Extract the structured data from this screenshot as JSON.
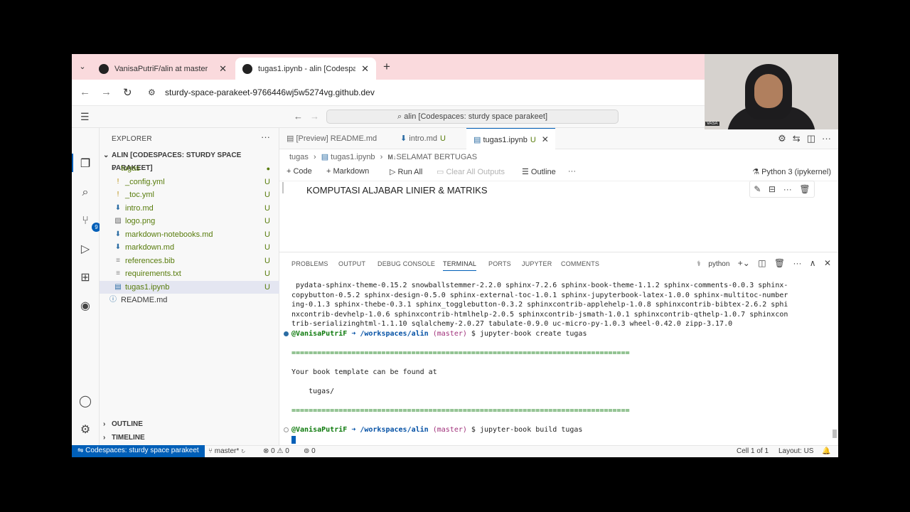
{
  "browser": {
    "tabs": [
      {
        "label": "VanisaPutriF/alin at master",
        "active": false
      },
      {
        "label": "tugas1.ipynb - alin [Codespaces",
        "active": true
      }
    ],
    "url": "sturdy-space-parakeet-9766446wj5w5274vg.github.dev"
  },
  "vscode": {
    "command_center": "alin [Codespaces: sturdy space parakeet]",
    "explorer": {
      "title": "EXPLORER",
      "workspace": "ALIN [CODESPACES: STURDY SPACE PARAKEET]",
      "folder": "tugas",
      "files": [
        {
          "name": "_config.yml",
          "icon": "!",
          "status": "U"
        },
        {
          "name": "_toc.yml",
          "icon": "!",
          "status": "U"
        },
        {
          "name": "intro.md",
          "icon": "⬇",
          "status": "U"
        },
        {
          "name": "logo.png",
          "icon": "▨",
          "status": "U"
        },
        {
          "name": "markdown-notebooks.md",
          "icon": "⬇",
          "status": "U"
        },
        {
          "name": "markdown.md",
          "icon": "⬇",
          "status": "U"
        },
        {
          "name": "references.bib",
          "icon": "≡",
          "status": "U"
        },
        {
          "name": "requirements.txt",
          "icon": "≡",
          "status": "U"
        },
        {
          "name": "tugas1.ipynb",
          "icon": "▤",
          "status": "U"
        }
      ],
      "readme": "README.md",
      "outline": "OUTLINE",
      "timeline": "TIMELINE",
      "scm_badge": "9"
    },
    "editor_tabs": [
      {
        "label": "[Preview] README.md",
        "dirty": ""
      },
      {
        "label": "intro.md",
        "dirty": "U"
      },
      {
        "label": "tugas1.ipynb",
        "dirty": "U"
      }
    ],
    "breadcrumb": {
      "folder": "tugas",
      "file": "tugas1.ipynb",
      "section": "SELAMAT BERTUGAS"
    },
    "notebook_toolbar": {
      "code": "Code",
      "markdown": "Markdown",
      "run_all": "Run All",
      "clear": "Clear All Outputs",
      "outline": "Outline",
      "kernel": "Python 3 (ipykernel)"
    },
    "cell_text": "KOMPUTASI ALJABAR LINIER & MATRIKS",
    "panel": {
      "tabs": [
        "PROBLEMS",
        "OUTPUT",
        "DEBUG CONSOLE",
        "TERMINAL",
        "PORTS",
        "JUPYTER",
        "COMMENTS"
      ],
      "active_tab": "TERMINAL",
      "shell": "python"
    },
    "terminal": {
      "output_lines": [
        " pydata-sphinx-theme-0.15.2 snowballstemmer-2.2.0 sphinx-7.2.6 sphinx-book-theme-1.1.2 sphinx-comments-0.0.3 sphinx-",
        "copybutton-0.5.2 sphinx-design-0.5.0 sphinx-external-toc-1.0.1 sphinx-jupyterbook-latex-1.0.0 sphinx-multitoc-number",
        "ing-0.1.3 sphinx-thebe-0.3.1 sphinx_togglebutton-0.3.2 sphinxcontrib-applehelp-1.0.8 sphinxcontrib-bibtex-2.6.2 sphi",
        "nxcontrib-devhelp-1.0.6 sphinxcontrib-htmlhelp-2.0.5 sphinxcontrib-jsmath-1.0.1 sphinxcontrib-qthelp-1.0.7 sphinxcon",
        "trib-serializinghtml-1.1.10 sqlalchemy-2.0.27 tabulate-0.9.0 uc-micro-py-1.0.3 wheel-0.42.0 zipp-3.17.0"
      ],
      "prompt_user": "@VanisaPutriF",
      "prompt_path": "➜ /workspaces/alin",
      "prompt_branch": "(master)",
      "cmd1": "$ jupyter-book create tugas",
      "rule": "===============================================================================",
      "msg": "Your book template can be found at",
      "path_line": "    tugas/",
      "cmd2": "$ jupyter-book build tugas"
    },
    "status": {
      "remote": "Codespaces: sturdy space parakeet",
      "branch": "master*",
      "problems": "⊗ 0 ⚠ 0",
      "ports": "⊚ 0",
      "cell": "Cell 1 of 1",
      "layout": "Layout: US"
    }
  },
  "webcam": {
    "label": "VASA"
  }
}
